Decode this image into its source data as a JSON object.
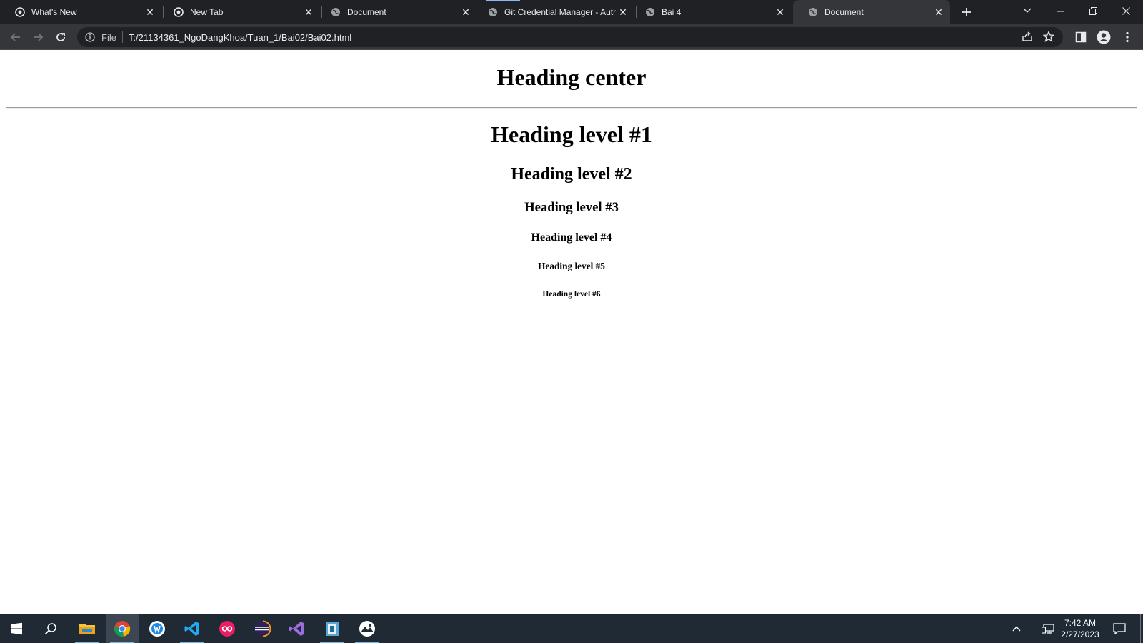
{
  "browser": {
    "tabs": [
      {
        "title": "What's New",
        "favicon": "chrome-icon",
        "active": false
      },
      {
        "title": "New Tab",
        "favicon": "chrome-icon",
        "active": false
      },
      {
        "title": "Document",
        "favicon": "globe-icon",
        "active": false
      },
      {
        "title": "Git Credential Manager - Auth",
        "favicon": "globe-icon",
        "active": false
      },
      {
        "title": "Bai 4",
        "favicon": "globe-icon",
        "active": false
      },
      {
        "title": "Document",
        "favicon": "globe-icon",
        "active": true
      }
    ],
    "address": {
      "scheme_label": "File",
      "url": "T:/21134361_NgoDangKhoa/Tuan_1/Bai02/Bai02.html"
    }
  },
  "page": {
    "heading_center": "Heading center",
    "h1": "Heading level #1",
    "h2": "Heading level #2",
    "h3": "Heading level #3",
    "h4": "Heading level #4",
    "h5": "Heading level #5",
    "h6": "Heading level #6"
  },
  "taskbar": {
    "apps": [
      "start-icon",
      "search-icon",
      "file-explorer-icon",
      "chrome-icon",
      "app-icon",
      "vscode-icon",
      "app-icon",
      "eclipse-icon",
      "visual-studio-icon",
      "app-icon",
      "app-icon"
    ],
    "clock": {
      "time": "7:42 AM",
      "date": "2/27/2023"
    }
  },
  "colors": {
    "tabstrip": "#202124",
    "toolbar": "#35363a",
    "omnibox": "#202124",
    "taskbar": "#1f2a35",
    "accent": "#8ab4f8"
  }
}
